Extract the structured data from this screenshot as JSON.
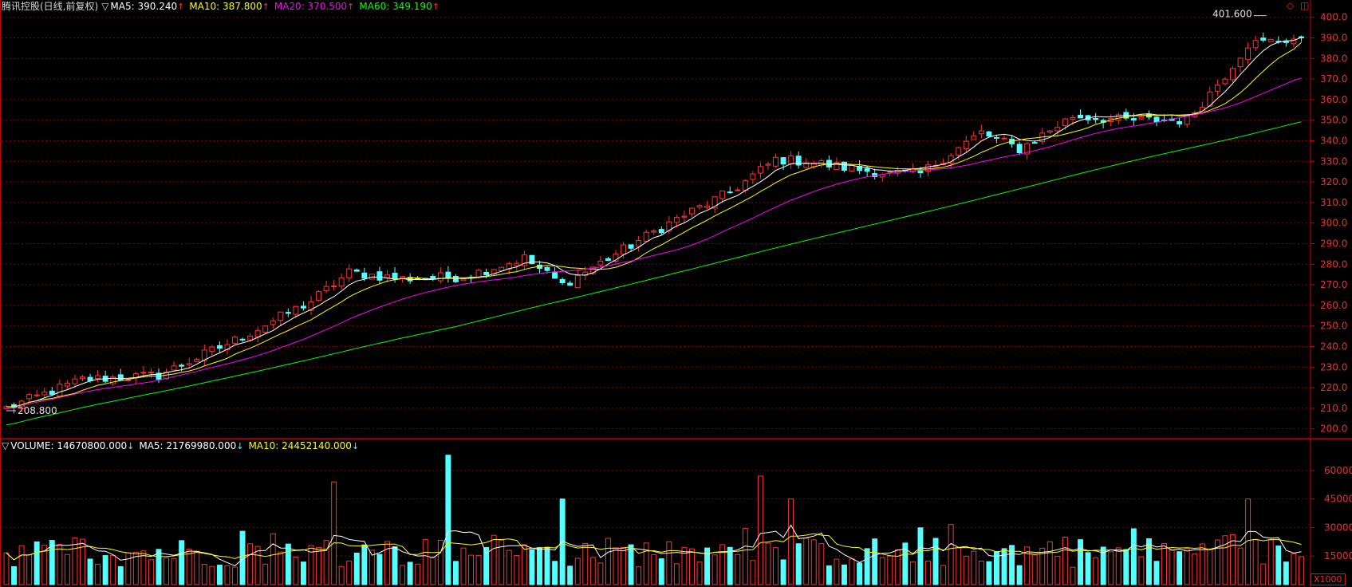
{
  "title": "腾讯控股(日线,前复权)",
  "colors": {
    "up": "#ff3232",
    "down": "#54ffff",
    "ma5": "#ffffff",
    "ma10": "#ffff00",
    "ma20": "#ff00ff",
    "ma60": "#00ff00",
    "grid": "#8a0000",
    "axis": "#c80000",
    "label": "#e83232",
    "value_up_arrow": "#ff3232",
    "value_down_arrow": "#54ffff"
  },
  "price_header": {
    "toggle": "▽",
    "ma5_label": "MA5: 390.240",
    "ma5_arrow": "↑",
    "ma10_label": "MA10: 387.800",
    "ma10_arrow": "↑",
    "ma20_label": "MA20: 370.500",
    "ma20_arrow": "↑",
    "ma60_label": "MA60: 349.190",
    "ma60_arrow": "↑"
  },
  "volume_header": {
    "toggle": "▽",
    "volume_label": "VOLUME: 14670800.000",
    "volume_arrow": "↓",
    "ma5_label": "MA5: 21769980.000",
    "ma5_arrow": "↓",
    "ma10_label": "MA10: 24452140.000",
    "ma10_arrow": "↓"
  },
  "volume_unit": "X1000",
  "top_icons": [
    "◇",
    "◫"
  ],
  "chart_data": [
    {
      "type": "candlestick",
      "title": "腾讯控股(日线,前复权)",
      "ylim": [
        196,
        403
      ],
      "yticks": [
        200,
        210,
        220,
        230,
        240,
        250,
        260,
        270,
        280,
        290,
        300,
        310,
        320,
        330,
        340,
        350,
        360,
        370,
        380,
        390,
        400
      ],
      "ytick_labels": [
        "200.0",
        "210.0",
        "220.0",
        "230.0",
        "240.0",
        "250.0",
        "260.0",
        "270.0",
        "280.0",
        "290.0",
        "300.0",
        "310.0",
        "320.0",
        "330.0",
        "340.0",
        "350.0",
        "360.0",
        "370.0",
        "380.0",
        "390.0",
        "400.0"
      ],
      "annotations": [
        {
          "text": "401.600",
          "value": 401.6,
          "kind": "high"
        },
        {
          "text": "208.800",
          "value": 208.8,
          "kind": "low"
        }
      ],
      "close_anchors": [
        {
          "i": 0,
          "v": 210
        },
        {
          "i": 10,
          "v": 224
        },
        {
          "i": 20,
          "v": 226
        },
        {
          "i": 30,
          "v": 243
        },
        {
          "i": 40,
          "v": 262
        },
        {
          "i": 45,
          "v": 276
        },
        {
          "i": 52,
          "v": 273
        },
        {
          "i": 60,
          "v": 274
        },
        {
          "i": 68,
          "v": 283
        },
        {
          "i": 73,
          "v": 270
        },
        {
          "i": 80,
          "v": 285
        },
        {
          "i": 88,
          "v": 302
        },
        {
          "i": 95,
          "v": 315
        },
        {
          "i": 101,
          "v": 331
        },
        {
          "i": 105,
          "v": 330
        },
        {
          "i": 110,
          "v": 327
        },
        {
          "i": 116,
          "v": 324
        },
        {
          "i": 120,
          "v": 324
        },
        {
          "i": 128,
          "v": 344
        },
        {
          "i": 133,
          "v": 336
        },
        {
          "i": 140,
          "v": 352
        },
        {
          "i": 147,
          "v": 350
        },
        {
          "i": 155,
          "v": 350
        },
        {
          "i": 160,
          "v": 372
        },
        {
          "i": 163,
          "v": 387
        },
        {
          "i": 170,
          "v": 390
        }
      ],
      "ma_lines": [
        {
          "name": "MA5",
          "start": 210.5,
          "end": 390.24
        },
        {
          "name": "MA10",
          "start": 210,
          "end": 387.8
        },
        {
          "name": "MA20",
          "start": 208,
          "end": 370.5
        },
        {
          "name": "MA60",
          "start": 199,
          "end": 349.19
        }
      ],
      "bar_count": 171
    },
    {
      "type": "bar",
      "title": "VOLUME",
      "unit": "X1000",
      "ylim": [
        0,
        70000
      ],
      "yticks": [
        15000,
        30000,
        45000,
        60000
      ],
      "ytick_labels": [
        "15000",
        "30000",
        "45000",
        "60000"
      ],
      "last_value": 14670.8,
      "ma5_last": 21769.98,
      "ma10_last": 24452.14,
      "tall_bars": [
        {
          "i": 43,
          "v": 54000
        },
        {
          "i": 58,
          "v": 68000
        },
        {
          "i": 73,
          "v": 45000
        },
        {
          "i": 99,
          "v": 57000
        },
        {
          "i": 103,
          "v": 45000
        },
        {
          "i": 163,
          "v": 45000
        }
      ],
      "bar_count": 171
    }
  ]
}
